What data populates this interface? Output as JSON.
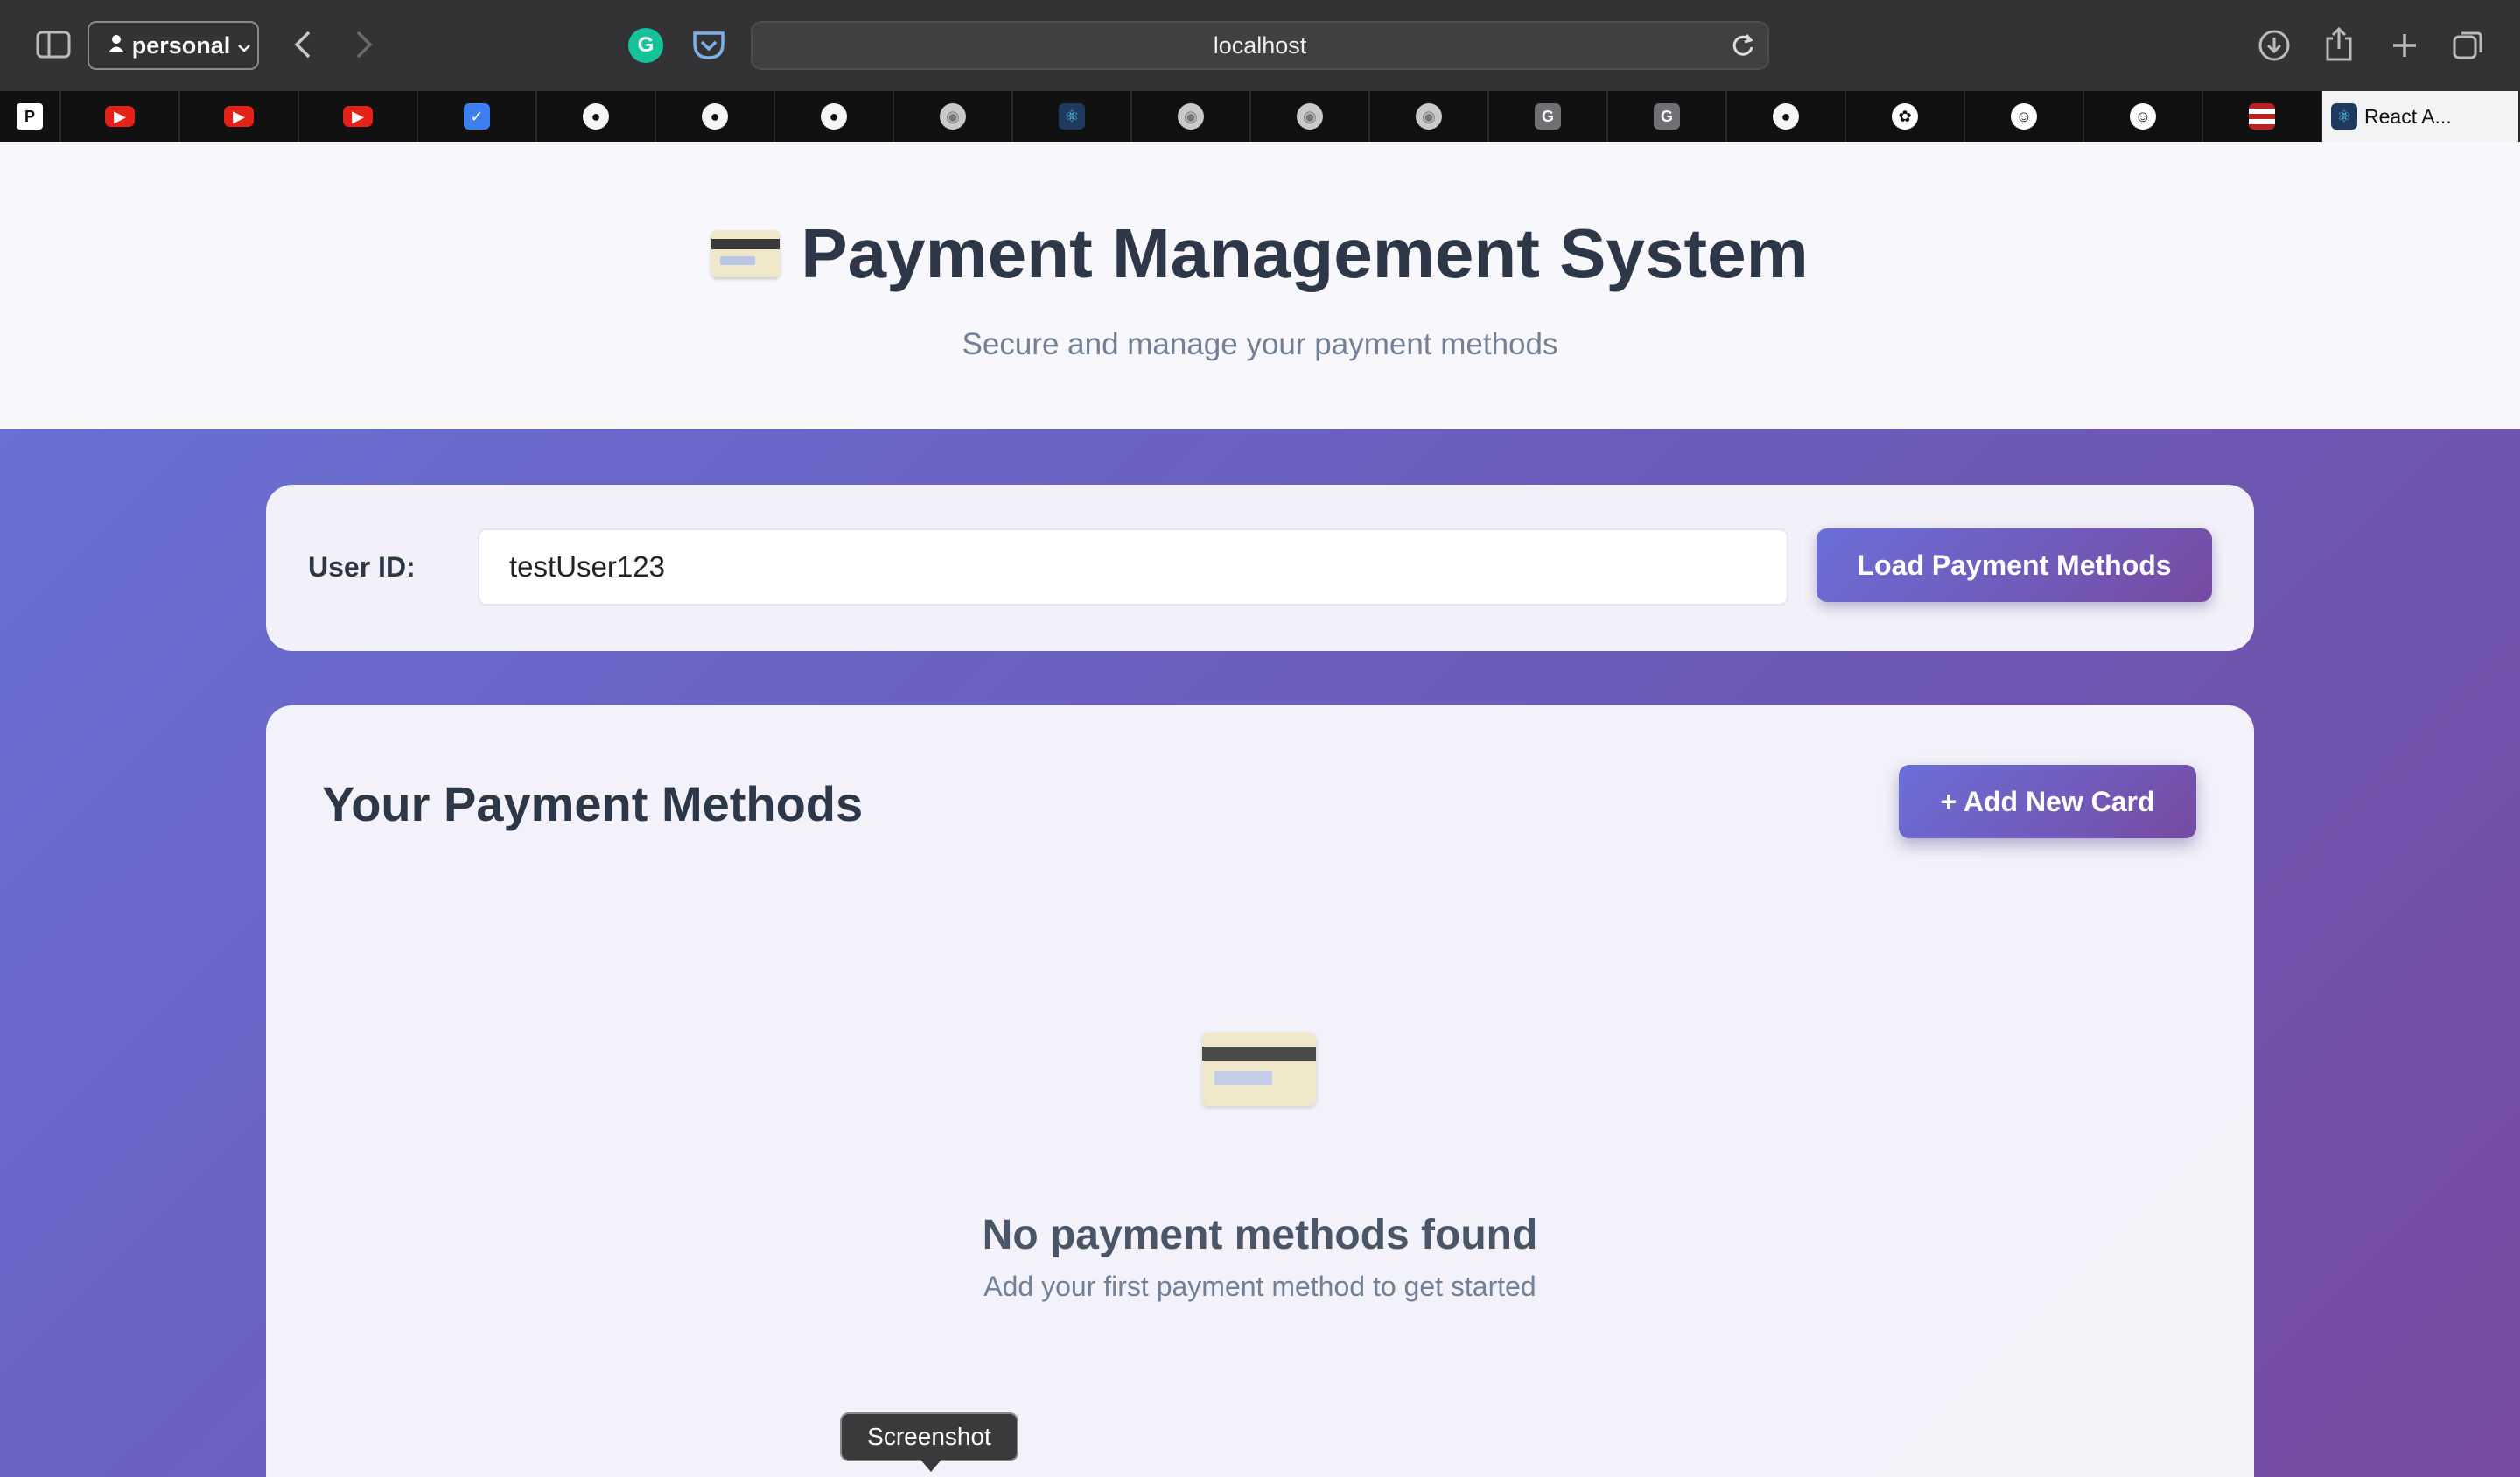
{
  "browser": {
    "profile_label": "personal",
    "address": "localhost",
    "tabs": [
      {
        "icon": "p-icon",
        "glyph": "P",
        "kind": "p"
      },
      {
        "icon": "youtube-icon",
        "glyph": "▶",
        "kind": "yt"
      },
      {
        "icon": "youtube-icon",
        "glyph": "▶",
        "kind": "yt"
      },
      {
        "icon": "youtube-icon",
        "glyph": "▶",
        "kind": "yt"
      },
      {
        "icon": "checkmark-icon",
        "glyph": "✓",
        "kind": "tick"
      },
      {
        "icon": "github-icon",
        "glyph": "●",
        "kind": "gh"
      },
      {
        "icon": "github-icon",
        "glyph": "●",
        "kind": "gh"
      },
      {
        "icon": "github-icon",
        "glyph": "●",
        "kind": "gh"
      },
      {
        "icon": "chrome-icon",
        "glyph": "◉",
        "kind": "chrome"
      },
      {
        "icon": "react-icon",
        "glyph": "⚛",
        "kind": "react"
      },
      {
        "icon": "chrome-icon",
        "glyph": "◉",
        "kind": "chrome"
      },
      {
        "icon": "chrome-icon",
        "glyph": "◉",
        "kind": "chrome"
      },
      {
        "icon": "chrome-icon",
        "glyph": "◉",
        "kind": "chrome"
      },
      {
        "icon": "g-icon",
        "glyph": "G",
        "kind": "g"
      },
      {
        "icon": "g-icon",
        "glyph": "G",
        "kind": "g"
      },
      {
        "icon": "github-icon",
        "glyph": "●",
        "kind": "gh"
      },
      {
        "icon": "openai-icon",
        "glyph": "✿",
        "kind": "ai"
      },
      {
        "icon": "avatar-icon",
        "glyph": "☺",
        "kind": "ai"
      },
      {
        "icon": "avatar-icon",
        "glyph": "☺",
        "kind": "ai"
      },
      {
        "icon": "flag-icon",
        "glyph": "",
        "kind": "flag"
      }
    ],
    "active_tab_label": "React A..."
  },
  "header": {
    "title": "Payment Management System",
    "subtitle": "Secure and manage your payment methods"
  },
  "user_panel": {
    "label": "User ID:",
    "input_value": "testUser123",
    "load_button": "Load Payment Methods"
  },
  "methods": {
    "title": "Your Payment Methods",
    "add_button": "+ Add New Card",
    "empty_title": "No payment methods found",
    "empty_subtitle": "Add your first payment method to get started"
  },
  "tooltip": "Screenshot"
}
